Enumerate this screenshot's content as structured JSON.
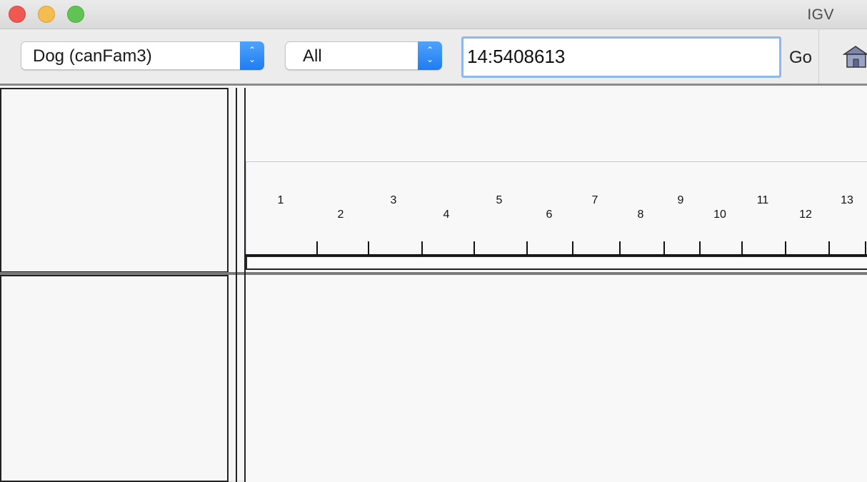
{
  "window": {
    "title": "IGV"
  },
  "toolbar": {
    "genome": "Dog (canFam3)",
    "chromosome": "All",
    "locus": "14:5408613",
    "go_label": "Go"
  },
  "ruler": {
    "chromosomes": [
      "1",
      "2",
      "3",
      "4",
      "5",
      "6",
      "7",
      "8",
      "9",
      "10",
      "11",
      "12",
      "13"
    ]
  }
}
